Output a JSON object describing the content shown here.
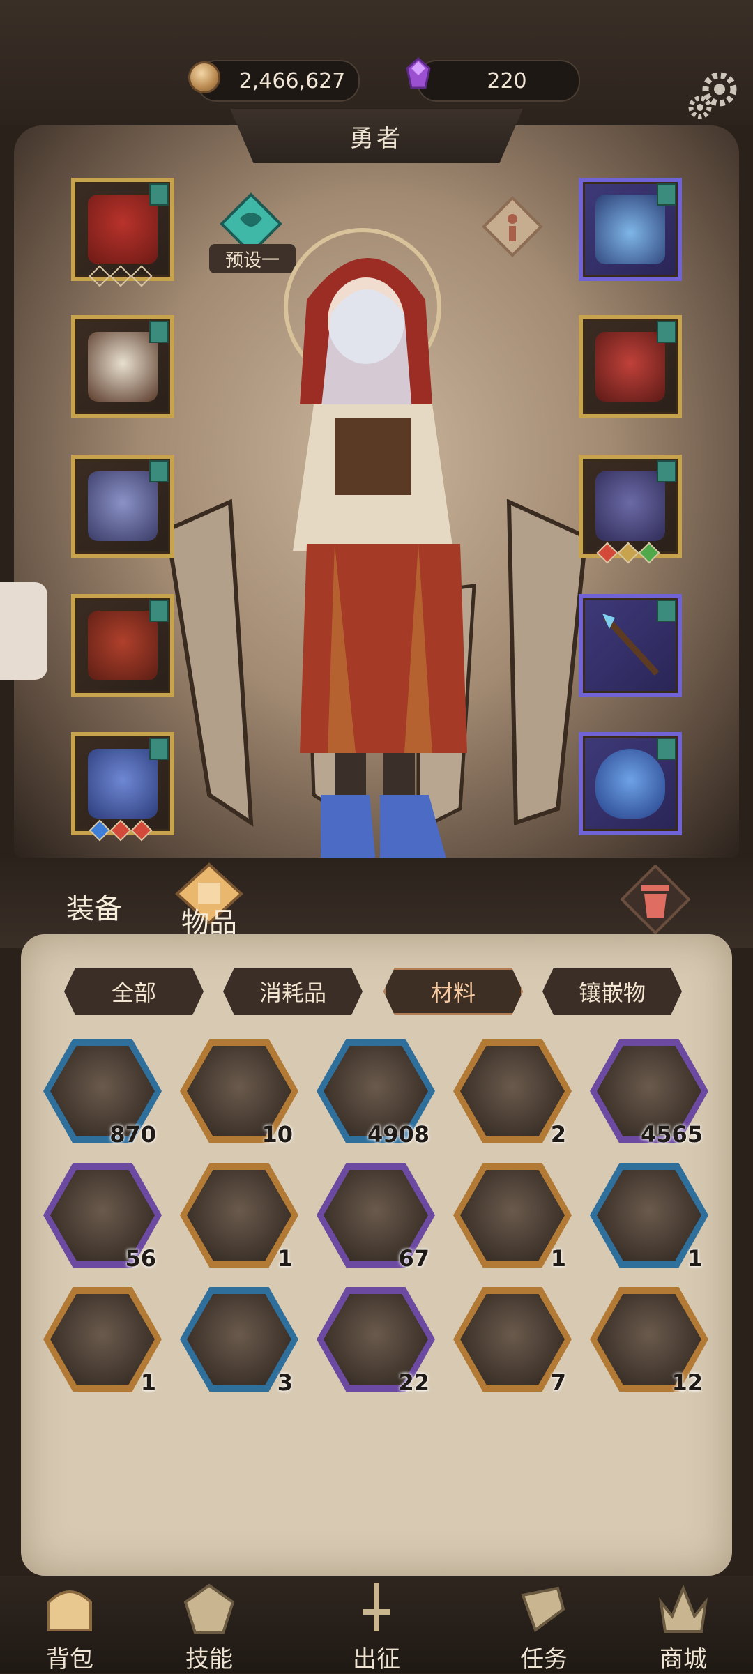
{
  "header": {
    "gold": "2,466,627",
    "gems": "220",
    "title": "勇者"
  },
  "hero": {
    "preset_label": "预设一"
  },
  "main_tabs": [
    "装备",
    "物品"
  ],
  "filters": [
    "全部",
    "消耗品",
    "材料",
    "镶嵌物"
  ],
  "active_filter": "材料",
  "items": [
    {
      "icon": "iron-ore-icon",
      "qty": "870",
      "frame": "#2f6f9c"
    },
    {
      "icon": "gold-ingot-icon",
      "qty": "10",
      "frame": "#b27a35"
    },
    {
      "icon": "dark-crystal-icon",
      "qty": "4908",
      "frame": "#2f6f9c"
    },
    {
      "icon": "quill-pen-icon",
      "qty": "2",
      "frame": "#b27a35"
    },
    {
      "icon": "crystal-cluster-icon",
      "qty": "4565",
      "frame": "#6d4aa1"
    },
    {
      "icon": "purple-ore-icon",
      "qty": "56",
      "frame": "#6d4aa1"
    },
    {
      "icon": "gold-potion-icon",
      "qty": "1",
      "frame": "#b27a35"
    },
    {
      "icon": "purple-potion-icon",
      "qty": "67",
      "frame": "#6d4aa1"
    },
    {
      "icon": "scroll-icon",
      "qty": "1",
      "frame": "#b27a35"
    },
    {
      "icon": "blue-scroll-icon",
      "qty": "1",
      "frame": "#2f6f9c"
    },
    {
      "icon": "purple-scroll-icon",
      "qty": "1",
      "frame": "#b27a35"
    },
    {
      "icon": "ice-rune-icon",
      "qty": "3",
      "frame": "#2f6f9c"
    },
    {
      "icon": "lightning-rune-icon",
      "qty": "22",
      "frame": "#6d4aa1"
    },
    {
      "icon": "earth-rune-icon",
      "qty": "7",
      "frame": "#b27a35"
    },
    {
      "icon": "fire-rune-icon",
      "qty": "12",
      "frame": "#b27a35"
    }
  ],
  "bottom_nav": [
    "背包",
    "技能",
    "出征",
    "任务",
    "商城"
  ],
  "colors": {
    "gold_frame": "#c7a34d",
    "purple_frame": "#6f63d6",
    "panel": "#d7c9b2",
    "dark_bar": "#2c231d"
  }
}
